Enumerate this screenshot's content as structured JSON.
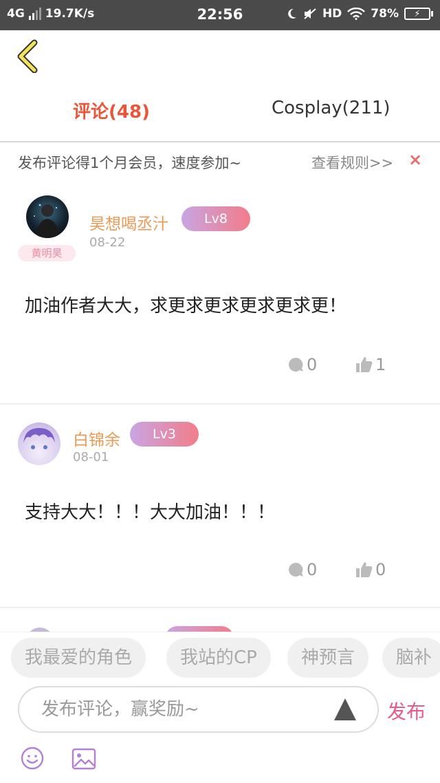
{
  "status_bar": {
    "network": "4G",
    "speed": "19.7K/s",
    "time": "22:56",
    "hd": "HD",
    "battery": "78%"
  },
  "tabs": [
    {
      "label": "评论(48)",
      "active": true
    },
    {
      "label": "Cosplay(211)",
      "active": false
    }
  ],
  "promo": {
    "text": "发布评论得1个月会员，速度参加~",
    "rules": "查看规则>>",
    "close": "×"
  },
  "comments": [
    {
      "username": "昊想喝丞汁",
      "level": "Lv8",
      "date": "08-22",
      "nameplate": "黄明昊",
      "content": "加油作者大大，求更求更求更求更求更！",
      "reply_count": "0",
      "like_count": "1"
    },
    {
      "username": "白锦余",
      "level": "Lv3",
      "date": "08-01",
      "content": "支持大大！！！大大加油！！！",
      "reply_count": "0",
      "like_count": "0"
    }
  ],
  "composer": {
    "chips": [
      "我最爱的角色",
      "我站的CP",
      "神预言",
      "脑补"
    ],
    "placeholder": "发布评论，赢奖励~",
    "publish": "发布"
  },
  "colors": {
    "accent": "#e8573a",
    "username": "#e89a55",
    "publish": "#e85a8a",
    "emoji": "#b57fd8"
  }
}
